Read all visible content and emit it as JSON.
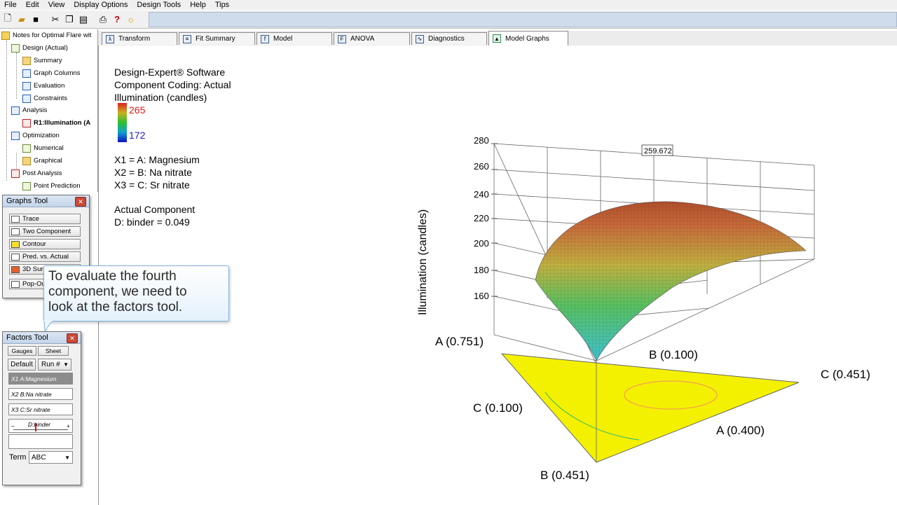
{
  "menu": [
    "File",
    "Edit",
    "View",
    "Display Options",
    "Design Tools",
    "Help",
    "Tips"
  ],
  "toolbar_icons": [
    "new-file-icon",
    "open-folder-icon",
    "save-icon",
    "cut-icon",
    "copy-icon",
    "paste-icon",
    "print-icon",
    "help-icon",
    "tip-icon"
  ],
  "tree": {
    "root": "Notes for Optimal Flare wit",
    "design": "Design (Actual)",
    "summary": "Summary",
    "graph_columns": "Graph Columns",
    "evaluation": "Evaluation",
    "constraints": "Constraints",
    "analysis": "Analysis",
    "response": "R1:Illumination (A",
    "optimization": "Optimization",
    "numerical": "Numerical",
    "graphical": "Graphical",
    "post_analysis": "Post Analysis",
    "point_prediction": "Point Prediction"
  },
  "tabs": [
    "Transform",
    "Fit Summary",
    "Model",
    "ANOVA",
    "Diagnostics",
    "Model Graphs"
  ],
  "info": {
    "line1": "Design-Expert® Software",
    "line2": "Component Coding: Actual",
    "line3": "Illumination (candles)",
    "legend_high": "265",
    "legend_low": "172",
    "x1": "X1 = A: Magnesium",
    "x2": "X2 = B: Na nitrate",
    "x3": "X3 = C: Sr nitrate",
    "actual_component": "Actual Component",
    "binder": "D: binder = 0.049"
  },
  "graphs_tool": {
    "title": "Graphs Tool",
    "buttons": [
      "Trace",
      "Two Component",
      "Contour",
      "Pred. vs. Actual",
      "3D Surf",
      "Pop-Out"
    ]
  },
  "callout": {
    "line1": "To evaluate the fourth",
    "line2": "component, we need to",
    "line3": "look at the factors tool."
  },
  "factors_tool": {
    "title": "Factors Tool",
    "gauges": "Gauges",
    "sheet": "Sheet",
    "default": "Default",
    "run": "Run #",
    "factors": [
      "X1 A:Magnesium",
      "X2 B:Na nitrate",
      "X3 C:Sr nitrate"
    ],
    "slider_label": "D:binder",
    "minus": "–",
    "plus": "+",
    "term_label": "Term",
    "term_value": "ABC"
  },
  "plot": {
    "ylabel": "Illumination (candles)",
    "z_ticks": [
      "280",
      "260",
      "240",
      "220",
      "200",
      "180",
      "160"
    ],
    "flag_value": "259.672",
    "vertex_labels": {
      "a_high": "A (0.751)",
      "b_low": "B (0.100)",
      "c_high": "C (0.451)",
      "c_low": "C (0.100)",
      "a_low": "A (0.400)",
      "b_high": "B (0.451)"
    },
    "colors": {
      "base": "#f4f100",
      "contour_orange": "#f2a050",
      "contour_green": "#4dc060"
    }
  }
}
